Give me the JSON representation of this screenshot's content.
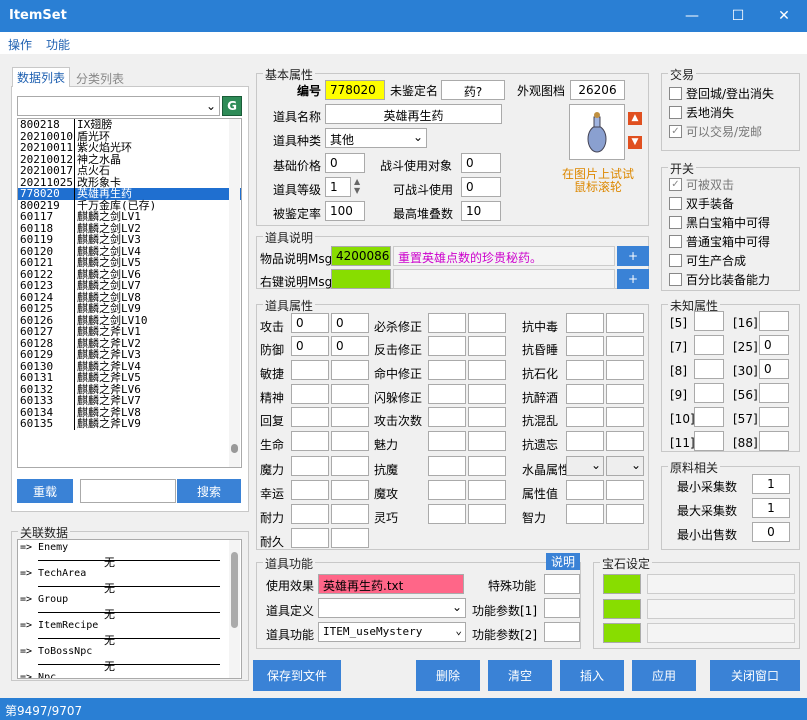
{
  "window": {
    "title": "ItemSet",
    "minimize": "—",
    "maximize": "☐",
    "close": "✕"
  },
  "menu": [
    "操作",
    "功能"
  ],
  "tabs": [
    "数据列表",
    "分类列表"
  ],
  "list_btn": "G",
  "items": [
    {
      "id": "800218",
      "name": "IX翅膀"
    },
    {
      "id": "20210010",
      "name": "盾光环"
    },
    {
      "id": "20210011",
      "name": "紫火焰光环"
    },
    {
      "id": "20210012",
      "name": "神之水晶"
    },
    {
      "id": "20210017",
      "name": "点火石"
    },
    {
      "id": "20211025",
      "name": "改形象卡"
    },
    {
      "id": "778020",
      "name": "英雄再生药"
    },
    {
      "id": "800219",
      "name": "千万金库(已存)"
    },
    {
      "id": "60117",
      "name": "麒麟之剑LV1"
    },
    {
      "id": "60118",
      "name": "麒麟之剑LV2"
    },
    {
      "id": "60119",
      "name": "麒麟之剑LV3"
    },
    {
      "id": "60120",
      "name": "麒麟之剑LV4"
    },
    {
      "id": "60121",
      "name": "麒麟之剑LV5"
    },
    {
      "id": "60122",
      "name": "麒麟之剑LV6"
    },
    {
      "id": "60123",
      "name": "麒麟之剑LV7"
    },
    {
      "id": "60124",
      "name": "麒麟之剑LV8"
    },
    {
      "id": "60125",
      "name": "麒麟之剑LV9"
    },
    {
      "id": "60126",
      "name": "麒麟之剑LV10"
    },
    {
      "id": "60127",
      "name": "麒麟之斧LV1"
    },
    {
      "id": "60128",
      "name": "麒麟之斧LV2"
    },
    {
      "id": "60129",
      "name": "麒麟之斧LV3"
    },
    {
      "id": "60130",
      "name": "麒麟之斧LV4"
    },
    {
      "id": "60131",
      "name": "麒麟之斧LV5"
    },
    {
      "id": "60132",
      "name": "麒麟之斧LV6"
    },
    {
      "id": "60133",
      "name": "麒麟之斧LV7"
    },
    {
      "id": "60134",
      "name": "麒麟之斧LV8"
    },
    {
      "id": "60135",
      "name": "麒麟之斧LV9"
    }
  ],
  "reload": "重载",
  "search": "搜索",
  "linked": {
    "title": "关联数据",
    "items": [
      {
        "name": "=> Enemy",
        "val": "无"
      },
      {
        "name": "=> TechArea",
        "val": "无"
      },
      {
        "name": "=> Group",
        "val": "无"
      },
      {
        "name": "=> ItemRecipe",
        "val": "无"
      },
      {
        "name": "=> ToBossNpc",
        "val": "无"
      },
      {
        "name": "=> Npc",
        "val": ""
      }
    ]
  },
  "basic": {
    "title": "基本属性",
    "no_l": "编号",
    "no": "778020",
    "unid_l": "未鉴定名",
    "unid": "药?",
    "look_l": "外观图档",
    "look": "26206",
    "name_l": "道具名称",
    "name": "英雄再生药",
    "type_l": "道具种类",
    "type": "其他",
    "price_l": "基础价格",
    "price": "0",
    "btl_l": "战斗使用对象",
    "btl": "0",
    "lv_l": "道具等级",
    "lv": "1",
    "canbtl_l": "可战斗使用",
    "canbtl": "0",
    "ident_l": "被鉴定率",
    "ident": "100",
    "stack_l": "最高堆叠数",
    "stack": "10",
    "preview": "在图片上试试鼠标滚轮"
  },
  "desc": {
    "title": "道具说明",
    "msg_l": "物品说明Msg",
    "msg_id": "4200086",
    "msg": "重置英雄点数的珍贵秘药。",
    "rmsg_l": "右键说明Msg",
    "plus": "+"
  },
  "attr": {
    "title": "道具属性",
    "col1": [
      {
        "l": "攻击",
        "a": "0",
        "b": "0"
      },
      {
        "l": "防御",
        "a": "0",
        "b": "0"
      },
      {
        "l": "敏捷"
      },
      {
        "l": "精神"
      },
      {
        "l": "回复"
      },
      {
        "l": "生命"
      },
      {
        "l": "魔力"
      },
      {
        "l": "幸运"
      },
      {
        "l": "耐力"
      },
      {
        "l": "耐久"
      }
    ],
    "col2": [
      "必杀修正",
      "反击修正",
      "命中修正",
      "闪躲修正",
      "攻击次数",
      "魅力",
      "抗魔",
      "魔攻",
      "灵巧"
    ],
    "col3": [
      "抗中毒",
      "抗昏睡",
      "抗石化",
      "抗醉酒",
      "抗混乱",
      "抗遗忘",
      "水晶属性",
      "属性值",
      "智力"
    ]
  },
  "func": {
    "title": "道具功能",
    "help": "说明",
    "eff_l": "使用效果",
    "eff": "英雄再生药.txt",
    "def_l": "道具定义",
    "fn_l": "道具功能",
    "fn": "ITEM_useMystery",
    "sp_l": "特殊功能",
    "p1_l": "功能参数[1]",
    "p2_l": "功能参数[2]"
  },
  "gem": {
    "title": "宝石设定"
  },
  "trade": {
    "title": "交易",
    "opts": [
      {
        "l": "登回城/登出消失",
        "c": false
      },
      {
        "l": "丢地消失",
        "c": false
      },
      {
        "l": "可以交易/宠邮",
        "c": true
      }
    ]
  },
  "switch": {
    "title": "开关",
    "opts": [
      {
        "l": "可被双击",
        "c": true
      },
      {
        "l": "双手装备",
        "c": false
      },
      {
        "l": "黑白宝箱中可得",
        "c": false
      },
      {
        "l": "普通宝箱中可得",
        "c": false
      },
      {
        "l": "可生产合成",
        "c": false
      },
      {
        "l": "百分比装备能力",
        "c": false
      }
    ]
  },
  "unknown": {
    "title": "未知属性",
    "rows": [
      {
        "a": "[5]",
        "av": "",
        "b": "[16]",
        "bv": ""
      },
      {
        "a": "[7]",
        "av": "",
        "b": "[25]",
        "bv": "0"
      },
      {
        "a": "[8]",
        "av": "",
        "b": "[30]",
        "bv": "0"
      },
      {
        "a": "[9]",
        "av": "",
        "b": "[56]",
        "bv": ""
      },
      {
        "a": "[10]",
        "av": "",
        "b": "[57]",
        "bv": ""
      },
      {
        "a": "[11]",
        "av": "",
        "b": "[88]",
        "bv": ""
      }
    ]
  },
  "material": {
    "title": "原料相关",
    "min_l": "最小采集数",
    "min": "1",
    "max_l": "最大采集数",
    "max": "1",
    "sell_l": "最小出售数",
    "sell": "0"
  },
  "actions": {
    "save": "保存到文件",
    "del": "删除",
    "clear": "清空",
    "insert": "插入",
    "apply": "应用",
    "close": "关闭窗口"
  },
  "status": "第9497/9707",
  "colors": {
    "accent": "#3a82d6",
    "yellow": "#ffff00",
    "green": "#88dd00",
    "pink": "#ff6688",
    "magenta": "#cc00cc",
    "orange": "#dd8800",
    "red": "#e05020"
  }
}
